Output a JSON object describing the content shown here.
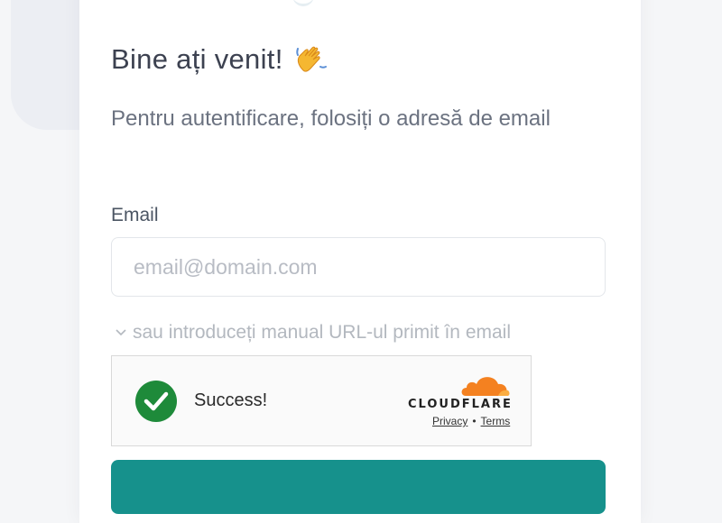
{
  "header": {
    "title": "Bine ați venit!",
    "subtitle": "Pentru autentificare, folosiți o adresă de email"
  },
  "form": {
    "email_label": "Email",
    "email_placeholder": "email@domain.com",
    "email_value": "",
    "manual_url_link": "sau introduceți manual URL-ul primit în email"
  },
  "captcha": {
    "status": "Success!",
    "brand": "CLOUDFLARE",
    "privacy": "Privacy",
    "separator": "•",
    "terms": "Terms"
  },
  "icons": {
    "wave": "waving-hand-icon",
    "check": "check-circle-icon",
    "chevron": "chevron-down-icon",
    "cloud": "cloudflare-cloud-icon"
  },
  "colors": {
    "accent": "#16918c",
    "success_green": "#1e8a3a",
    "cloudflare_orange": "#f48120",
    "text_dark": "#3c4150"
  }
}
